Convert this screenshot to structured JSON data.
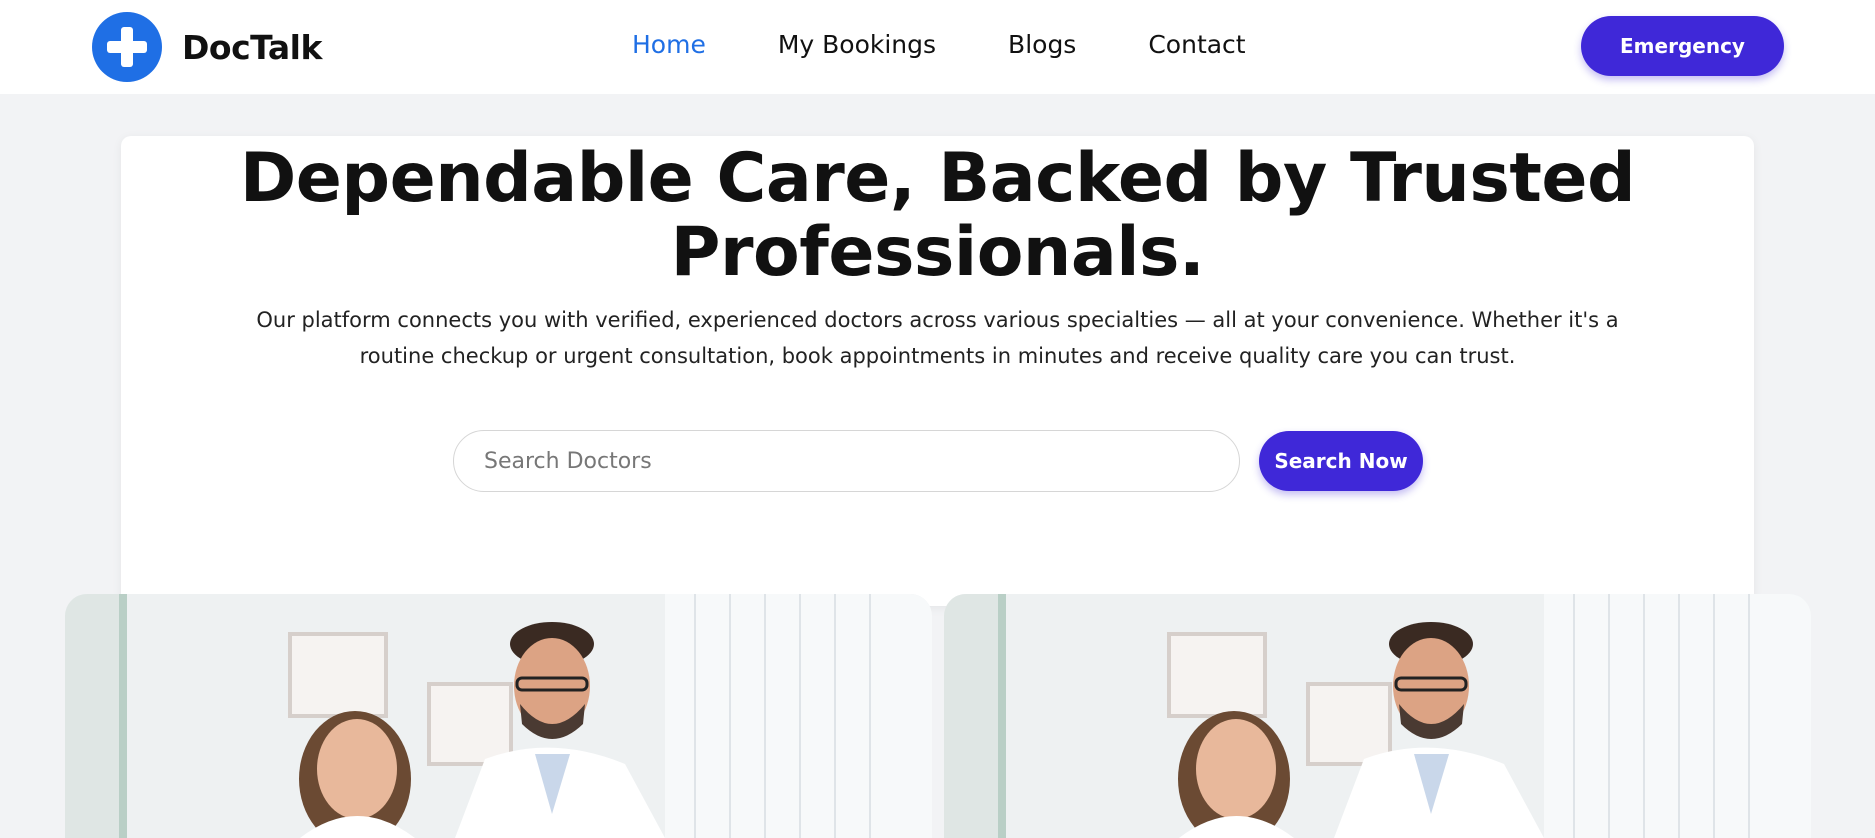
{
  "header": {
    "brand_name": "DocTalk",
    "logo_icon": "medical-cross-icon",
    "nav": [
      {
        "label": "Home",
        "active": true
      },
      {
        "label": "My Bookings",
        "active": false
      },
      {
        "label": "Blogs",
        "active": false
      },
      {
        "label": "Contact",
        "active": false
      }
    ],
    "emergency_label": "Emergency"
  },
  "hero": {
    "title_line1": "Dependable Care, Backed by Trusted",
    "title_line2": "Professionals.",
    "description_line1": "Our platform connects you with verified, experienced doctors across various specialties — all at your convenience. Whether it's a",
    "description_line2": "routine checkup or urgent consultation, book appointments in minutes and receive quality care you can trust.",
    "search_placeholder": "Search Doctors",
    "search_button_label": "Search Now"
  },
  "images": [
    {
      "subject": "two smiling doctors in white coats"
    },
    {
      "subject": "two smiling doctors in white coats"
    }
  ],
  "colors": {
    "accent": "#3f28d8",
    "nav_active": "#1f6fe5",
    "logo": "#1f6fe5",
    "page_bg": "#f2f3f5"
  }
}
